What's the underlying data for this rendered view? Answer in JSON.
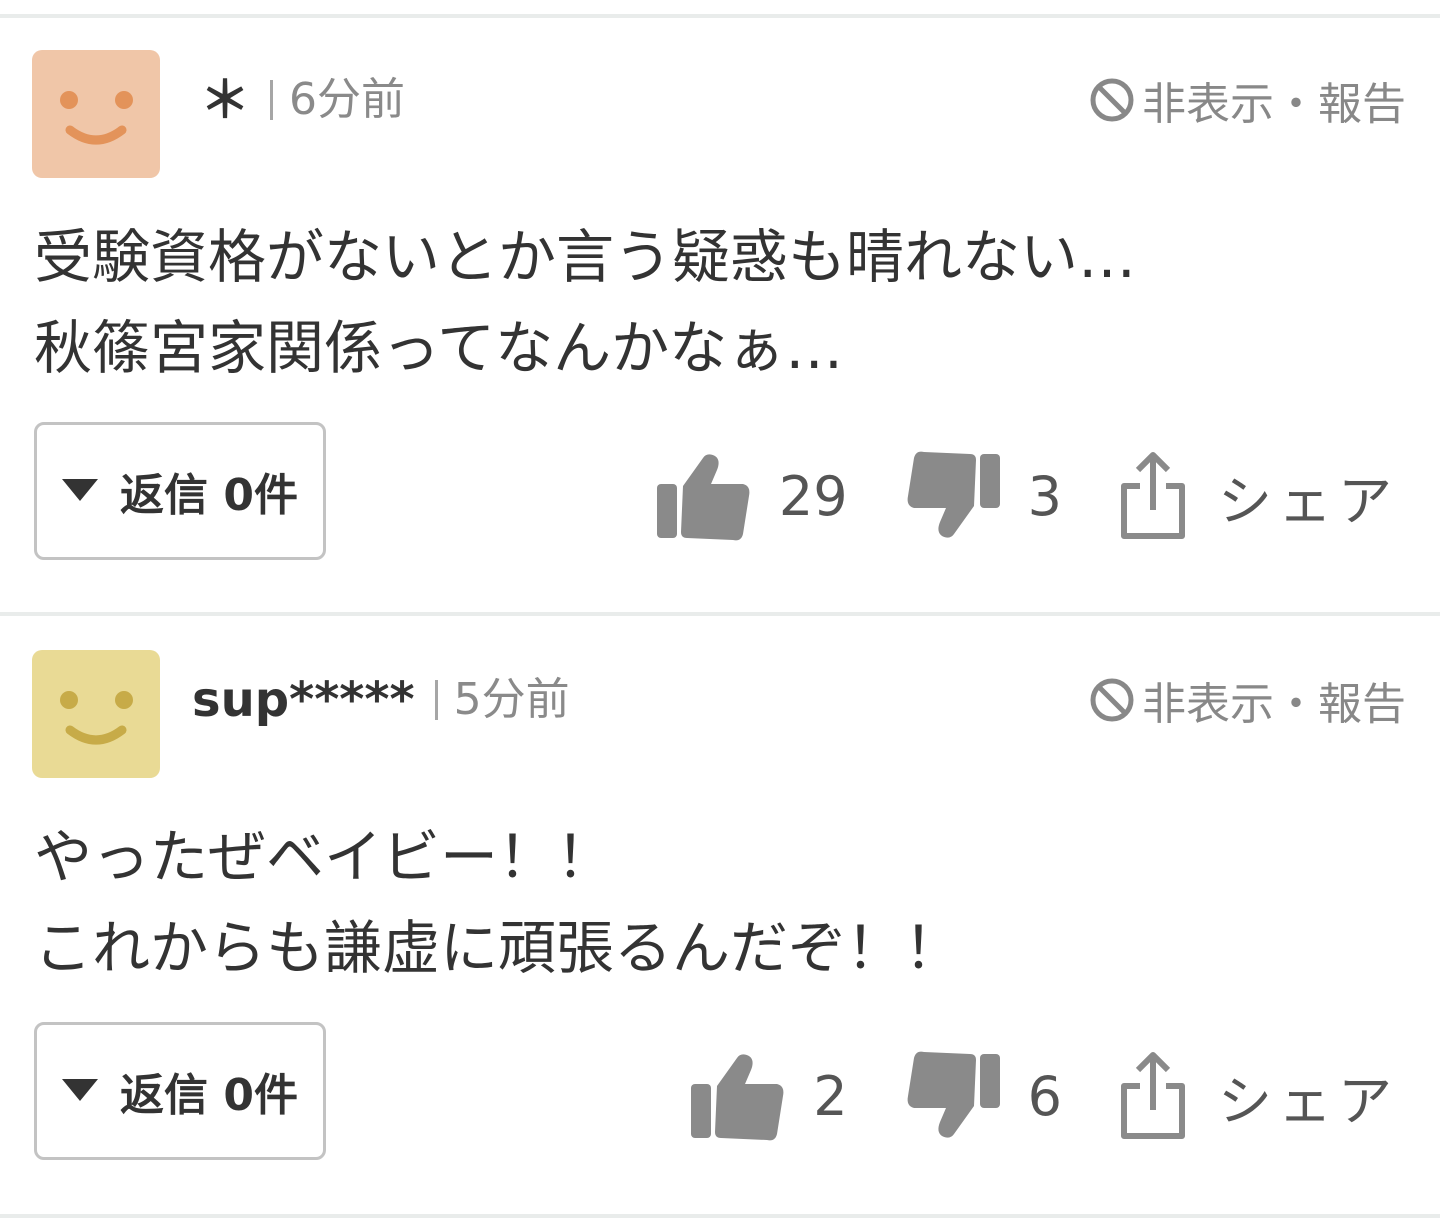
{
  "report_label": "非表示・報告",
  "comments": [
    {
      "username": "＊",
      "time": "6分前",
      "avatar_color": "#f0c6a8",
      "avatar_face_color": "#e3935a",
      "lines": [
        "受験資格がないとか言う疑惑も晴れない…",
        "秋篠宮家関係ってなんかなぁ…"
      ],
      "reply_label": "返信 0件",
      "likes": "29",
      "dislikes": "3",
      "share_label": "シェア"
    },
    {
      "username": "sup*****",
      "time": "5分前",
      "avatar_color": "#e9da95",
      "avatar_face_color": "#c7ab48",
      "lines": [
        "やったぜベイビー！！",
        "これからも謙虚に頑張るんだぞ！！"
      ],
      "reply_label": "返信 0件",
      "likes": "2",
      "dislikes": "6",
      "share_label": "シェア"
    }
  ]
}
